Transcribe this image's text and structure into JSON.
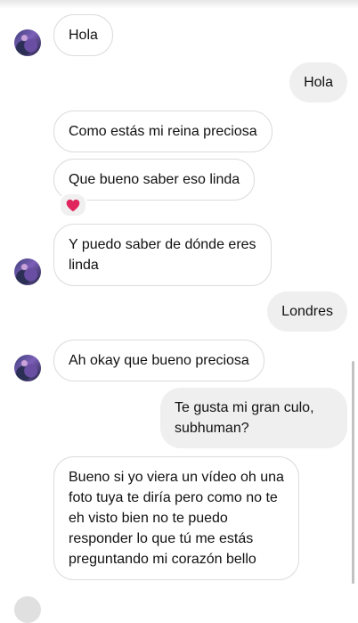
{
  "messages": [
    {
      "id": "m1",
      "side": "received",
      "text": "Hola"
    },
    {
      "id": "m2",
      "side": "sent",
      "text": "Hola"
    },
    {
      "id": "m3",
      "side": "received",
      "text": "Como estás mi reina preciosa"
    },
    {
      "id": "m4",
      "side": "received",
      "text": "Que bueno saber eso linda",
      "reaction": "❤️"
    },
    {
      "id": "m5",
      "side": "received",
      "text": "Y puedo saber de dónde eres\nlinda"
    },
    {
      "id": "m6",
      "side": "sent",
      "text": "Londres"
    },
    {
      "id": "m7",
      "side": "received",
      "text": "Ah okay que bueno preciosa"
    },
    {
      "id": "m8",
      "side": "sent",
      "text": "Te gusta mi gran culo,\nsubhuman?"
    },
    {
      "id": "m9",
      "side": "received",
      "text": "Bueno si yo viera un vídeo oh una\nfoto tuya te diría pero como no te\neh visto bien no te puedo\nresponder lo que tú me estás\npreguntando mi corazón bello"
    }
  ],
  "icons": {
    "avatar": "contact-avatar",
    "reaction": "red-heart-icon"
  },
  "colors": {
    "sent_bubble": "#efefef",
    "received_border": "#dcdcdc",
    "heart": "#e0245e"
  }
}
